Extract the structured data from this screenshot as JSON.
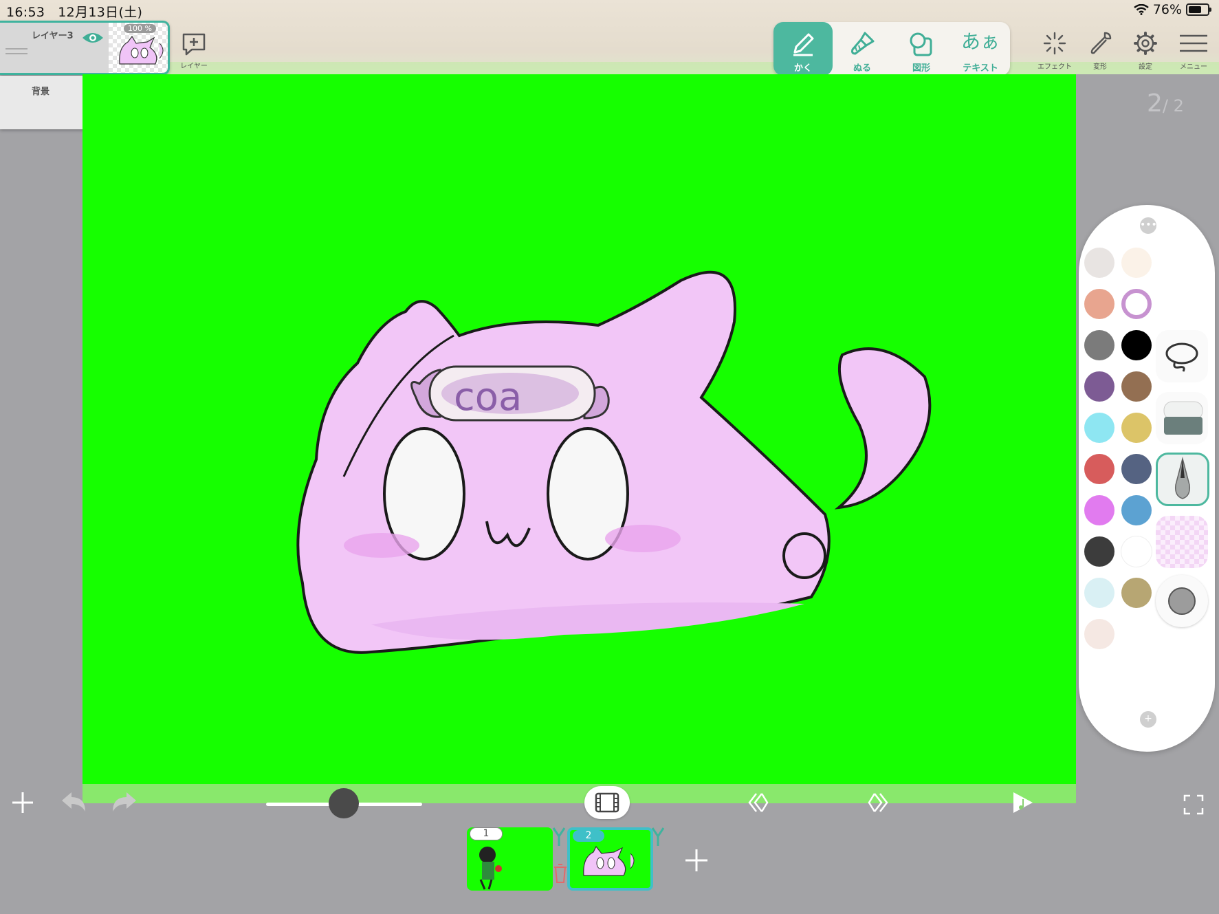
{
  "status_bar": {
    "time": "16:53",
    "date": "12月13日(土)",
    "battery": "76%"
  },
  "layers": [
    {
      "name": "レイヤー3",
      "opacity": "100 %",
      "visible": true
    },
    {
      "name": "背景"
    }
  ],
  "add_layer_label": "レイヤー",
  "tools": [
    {
      "label": "かく",
      "icon": "pencil-icon",
      "active": true
    },
    {
      "label": "ぬる",
      "icon": "brush-icon",
      "active": false
    },
    {
      "label": "図形",
      "icon": "shapes-icon",
      "active": false
    },
    {
      "label": "テキスト",
      "glyph": "あぁ",
      "icon": "text-icon",
      "active": false
    }
  ],
  "right_tools": [
    {
      "label": "エフェクト",
      "icon": "sparkle-icon"
    },
    {
      "label": "変形",
      "icon": "wrench-icon"
    },
    {
      "label": "設定",
      "icon": "gear-icon"
    },
    {
      "label": "メニュー",
      "icon": "hamburger-icon"
    }
  ],
  "page_indicator": {
    "current": "2",
    "total": "2"
  },
  "canvas": {
    "background": "#16ff00",
    "drawing_text": "coa"
  },
  "palette": {
    "colors": [
      "#e8e4e2",
      "#fbf2e8",
      "#e8a58f",
      "#c792d0",
      "#7b7b7b",
      "#000000",
      "#7d5b94",
      "#936f52",
      "#8ee6f2",
      "#dcc468",
      "#d75c5c",
      "#556382",
      "#e17bef",
      "#5ca2d2",
      "#3c3c3c",
      "#ffffff",
      "#d9f0f4",
      "#b7a673",
      "#f5e8e3"
    ],
    "tools": [
      "lasso-icon",
      "eraser-icon",
      "pen-icon",
      "texture-icon",
      "gray-dot-icon"
    ]
  },
  "frames": [
    {
      "number": "1"
    },
    {
      "number": "2"
    }
  ],
  "accent": "#4db89f"
}
